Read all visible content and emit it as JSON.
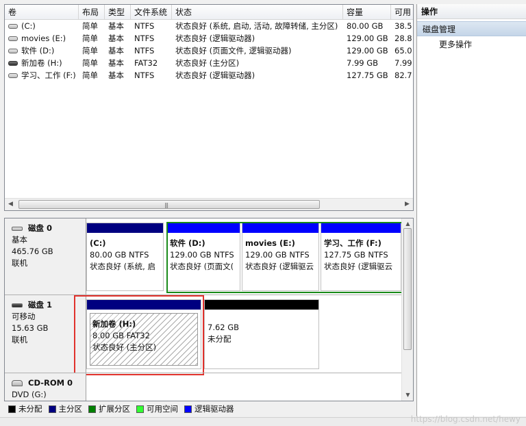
{
  "columns": {
    "volume": "卷",
    "layout": "布局",
    "type": "类型",
    "fs": "文件系统",
    "status": "状态",
    "capacity": "容量",
    "free": "可用"
  },
  "volumes": [
    {
      "name": "(C:)",
      "layout": "简单",
      "type": "基本",
      "fs": "NTFS",
      "status": "状态良好 (系统, 启动, 活动, 故障转储, 主分区)",
      "capacity": "80.00 GB",
      "free": "38.5"
    },
    {
      "name": "movies (E:)",
      "layout": "简单",
      "type": "基本",
      "fs": "NTFS",
      "status": "状态良好 (逻辑驱动器)",
      "capacity": "129.00 GB",
      "free": "28.8"
    },
    {
      "name": "软件 (D:)",
      "layout": "简单",
      "type": "基本",
      "fs": "NTFS",
      "status": "状态良好 (页面文件, 逻辑驱动器)",
      "capacity": "129.00 GB",
      "free": "65.0"
    },
    {
      "name": "新加卷 (H:)",
      "layout": "简单",
      "type": "基本",
      "fs": "FAT32",
      "status": "状态良好 (主分区)",
      "capacity": "7.99 GB",
      "free": "7.99"
    },
    {
      "name": "学习、工作 (F:)",
      "layout": "简单",
      "type": "基本",
      "fs": "NTFS",
      "status": "状态良好 (逻辑驱动器)",
      "capacity": "127.75 GB",
      "free": "82.7"
    }
  ],
  "disks": [
    {
      "title": "磁盘 0",
      "kind": "基本",
      "size": "465.76 GB",
      "state": "联机",
      "partitions": [
        {
          "name": "(C:)",
          "detail": "80.00 GB NTFS",
          "status": "状态良好 (系统, 启",
          "bar_color": "#000080"
        },
        {
          "name": "软件  (D:)",
          "detail": "129.00 GB NTFS",
          "status": "状态良好 (页面文(",
          "bar_color": "#0000ff"
        },
        {
          "name": "movies  (E:)",
          "detail": "129.00 GB NTFS",
          "status": "状态良好 (逻辑驱云",
          "bar_color": "#0000ff"
        },
        {
          "name": "学习、工作  (F:)",
          "detail": "127.75 GB NTFS",
          "status": "状态良好 (逻辑驱云",
          "bar_color": "#0000ff"
        }
      ]
    },
    {
      "title": "磁盘 1",
      "kind": "可移动",
      "size": "15.63 GB",
      "state": "联机",
      "partitions": [
        {
          "name": "新加卷  (H:)",
          "detail": "8.00 GB FAT32",
          "status": "状态良好 (主分区)",
          "bar_color": "#000080"
        },
        {
          "name": "",
          "detail": "7.62 GB",
          "status": "未分配",
          "bar_color": "#000000"
        }
      ]
    },
    {
      "title": "CD-ROM 0",
      "kind": "DVD (G:)"
    }
  ],
  "legend": [
    {
      "label": "未分配",
      "color": "#000000"
    },
    {
      "label": "主分区",
      "color": "#000080"
    },
    {
      "label": "扩展分区",
      "color": "#008000"
    },
    {
      "label": "可用空间",
      "color": "#33ff33"
    },
    {
      "label": "逻辑驱动器",
      "color": "#0000ff"
    }
  ],
  "actions": {
    "header": "操作",
    "section": "磁盘管理",
    "more": "更多操作"
  },
  "watermark": "https://blog.csdn.net/hewy"
}
